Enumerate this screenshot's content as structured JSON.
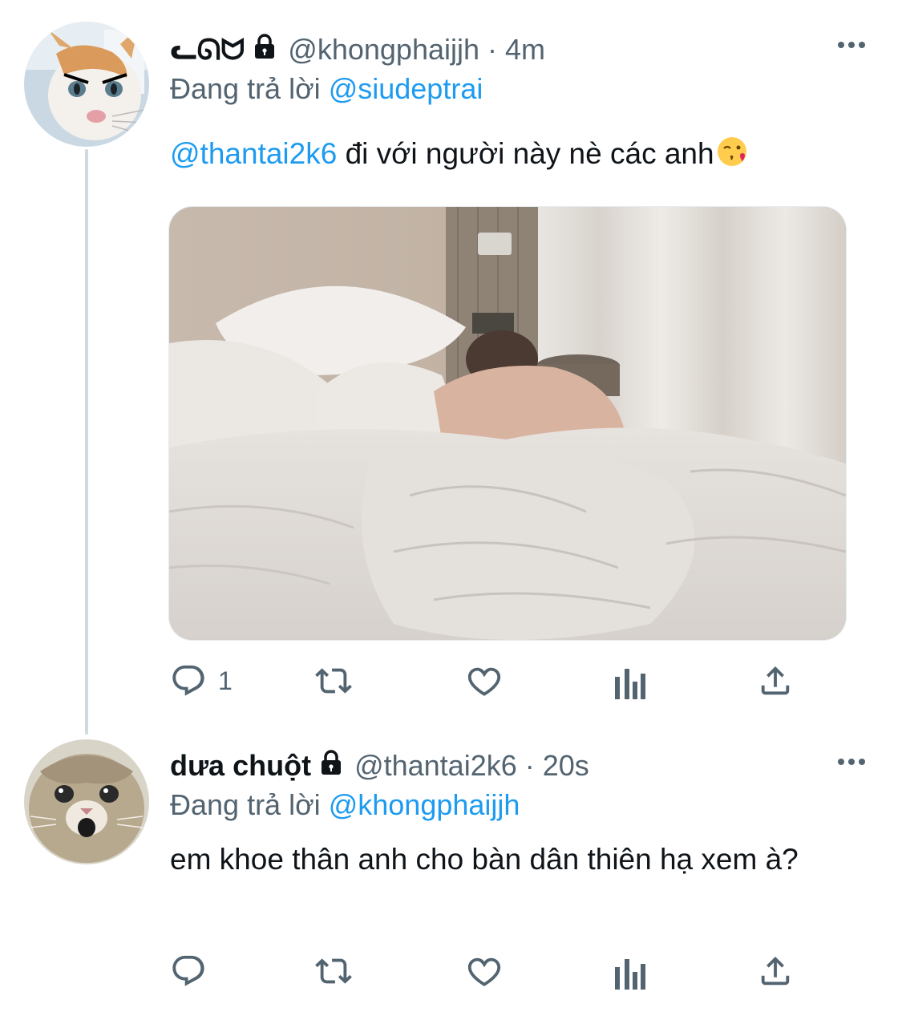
{
  "tweets": [
    {
      "display_name": "ᓚᘏᗢ",
      "handle": "@khongphaijjh",
      "separator": "·",
      "time": "4m",
      "replying_prefix": "Đang trả lời",
      "replying_to": "@siudeptrai",
      "mention": "@thantai2k6",
      "text": " đi với người này nè các anh",
      "emoji": "kissing-face-with-heart-emoji",
      "reply_count": "1",
      "media_description_icon": "photo-bed"
    },
    {
      "display_name": "dưa chuột",
      "handle": "@thantai2k6",
      "separator": "·",
      "time": "20s",
      "replying_prefix": "Đang trả lời",
      "replying_to": "@khongphaijjh",
      "text": "em khoe thân anh cho bàn dân thiên hạ xem à?",
      "reply_count": ""
    }
  ],
  "icons": {
    "lock": "lock-icon",
    "more": "more-icon",
    "reply": "reply-icon",
    "retweet": "retweet-icon",
    "like": "heart-icon",
    "views": "analytics-icon",
    "share": "share-icon"
  },
  "colors": {
    "accent": "#1d9bf0",
    "secondary_text": "#536471",
    "thread_line": "#cfd9de"
  }
}
